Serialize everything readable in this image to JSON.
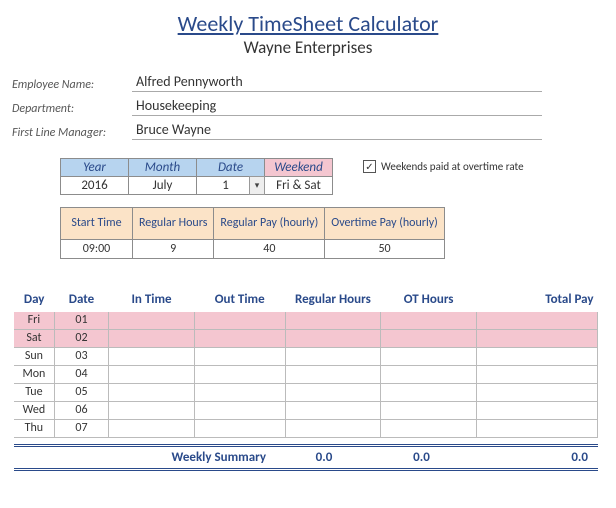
{
  "header": {
    "title": "Weekly TimeSheet Calculator",
    "company": "Wayne Enterprises"
  },
  "employee": {
    "name_label": "Employee Name:",
    "name": "Alfred Pennyworth",
    "dept_label": "Department:",
    "dept": "Housekeeping",
    "mgr_label": "First Line Manager:",
    "mgr": "Bruce Wayne"
  },
  "config": {
    "headers": {
      "year": "Year",
      "month": "Month",
      "date": "Date",
      "weekend": "Weekend"
    },
    "year": "2016",
    "month": "July",
    "date": "1",
    "weekend": "Fri & Sat",
    "ot_checkbox_label": "Weekends paid at overtime rate",
    "ot_checked": true
  },
  "pay": {
    "headers": {
      "start": "Start Time",
      "hours": "Regular Hours",
      "reg_rate": "Regular Pay (hourly)",
      "ot_rate": "Overtime Pay (hourly)"
    },
    "start": "09:00",
    "hours": "9",
    "reg_rate": "40",
    "ot_rate": "50"
  },
  "week": {
    "headers": {
      "day": "Day",
      "date": "Date",
      "in": "In Time",
      "out": "Out Time",
      "reg": "Regular Hours",
      "ot": "OT Hours",
      "pay": "Total Pay"
    },
    "rows": [
      {
        "day": "Fri",
        "date": "01",
        "weekend": true
      },
      {
        "day": "Sat",
        "date": "02",
        "weekend": true
      },
      {
        "day": "Sun",
        "date": "03",
        "weekend": false
      },
      {
        "day": "Mon",
        "date": "04",
        "weekend": false
      },
      {
        "day": "Tue",
        "date": "05",
        "weekend": false
      },
      {
        "day": "Wed",
        "date": "06",
        "weekend": false
      },
      {
        "day": "Thu",
        "date": "07",
        "weekend": false
      }
    ]
  },
  "summary": {
    "label": "Weekly Summary",
    "reg": "0.0",
    "ot": "0.0",
    "pay": "0.0"
  }
}
